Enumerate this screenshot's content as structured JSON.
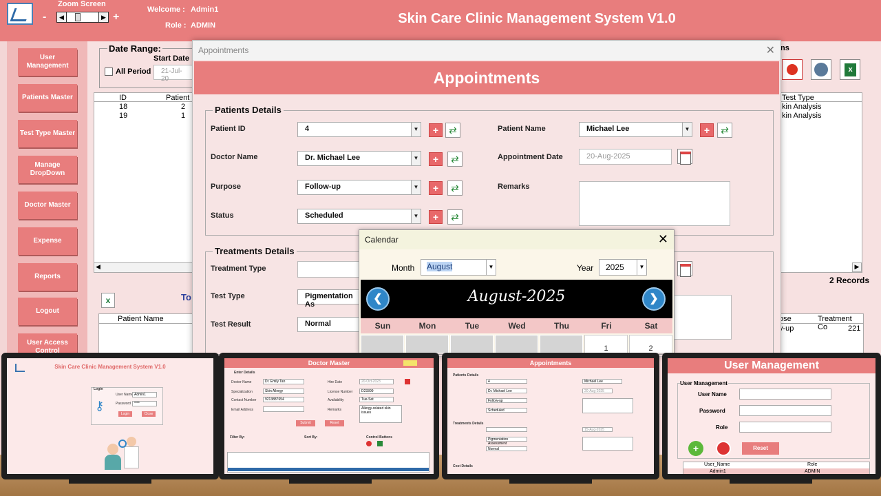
{
  "app": {
    "title": "Skin Care Clinic Management System V1.0",
    "zoom_label": "Zoom Screen",
    "zoom_minus": "-",
    "zoom_plus": "+",
    "welcome_label": "Welcome :",
    "welcome_value": "Admin1",
    "role_label": "Role :",
    "role_value": "ADMIN"
  },
  "sidebar": {
    "items": [
      {
        "label": "User Management"
      },
      {
        "label": "Patients Master"
      },
      {
        "label": "Test Type Master"
      },
      {
        "label": "Manage DropDown"
      },
      {
        "label": "Doctor Master"
      },
      {
        "label": "Expense"
      },
      {
        "label": "Reports"
      },
      {
        "label": "Logout"
      },
      {
        "label": "User Access Control"
      }
    ]
  },
  "background": {
    "date_range_label": "Date Range:",
    "start_date_label": "Start Date",
    "all_period_label": "All Period",
    "start_date_value": "21-Jul-20",
    "table_col_id": "ID",
    "table_col_patient": "Patient",
    "rows": [
      {
        "id": "18",
        "patient": "2"
      },
      {
        "id": "19",
        "patient": "1"
      }
    ],
    "right_col_test_type": "Test Type",
    "right_rows": [
      "kin Analysis",
      "kin Analysis"
    ],
    "ns_text": "ns",
    "records_text": "2 Records",
    "to_text": "To",
    "bottom_col_patient_name": "Patient Name",
    "bottom_col_pose": "ose",
    "bottom_col_treatment_cost": "Treatment Co",
    "bottom_row_up": "v-up",
    "bottom_row_cost": "221"
  },
  "appointments": {
    "window_title": "Appointments",
    "header": "Appointments",
    "patients_frame": "Patients Details",
    "patient_id_label": "Patient ID",
    "patient_id_value": "4",
    "patient_name_label": "Patient Name",
    "patient_name_value": "Michael Lee",
    "doctor_name_label": "Doctor Name",
    "doctor_name_value": "Dr. Michael Lee",
    "appointment_date_label": "Appointment Date",
    "appointment_date_value": "20-Aug-2025",
    "purpose_label": "Purpose",
    "purpose_value": "Follow-up",
    "remarks_label": "Remarks",
    "status_label": "Status",
    "status_value": "Scheduled",
    "treatments_frame": "Treatments Details",
    "treatment_type_label": "Treatment Type",
    "test_type_label": "Test Type",
    "test_type_value": "Pigmentation As",
    "test_result_label": "Test Result",
    "test_result_value": "Normal"
  },
  "calendar": {
    "title": "Calendar",
    "month_label": "Month",
    "month_value": "August",
    "year_label": "Year",
    "year_value": "2025",
    "banner": "August-2025",
    "days": [
      "Sun",
      "Mon",
      "Tue",
      "Wed",
      "Thu",
      "Fri",
      "Sat"
    ],
    "first_row": [
      "",
      "",
      "",
      "",
      "",
      "1",
      "2"
    ]
  },
  "monitors": {
    "m1_title": "Skin Care Clinic Management System V1.0",
    "m1_login": "Login",
    "m1_user_name": "User Name",
    "m1_user_value": "Admin1",
    "m1_password": "Password",
    "m1_password_value": "****",
    "m1_login_btn": "Login",
    "m1_close_btn": "Close",
    "m2_title": "Doctor Master",
    "m2_section": "Enter Details",
    "m2_doctor_name_label": "Doctor Name",
    "m2_doctor_name": "Dr. Emily Tan",
    "m2_hire_date_label": "Hire Date",
    "m2_hire_date": "20-Oct-2023",
    "m2_specialization_label": "Specialization",
    "m2_specialization": "Skin Allergy",
    "m2_license_label": "License Number",
    "m2_license": "D23399",
    "m2_contact_label": "Contact Number",
    "m2_contact": "9213887654",
    "m2_availability_label": "Availability",
    "m2_availability": "Tue-Sat",
    "m2_email_label": "Email Address",
    "m2_remarks_label": "Remarks",
    "m2_remarks": "Allergy-related skin issues",
    "m2_submit": "Submit",
    "m2_reset": "Reset",
    "m2_filter_by": "Filter By:",
    "m2_sort_by": "Sort By:",
    "m2_control_buttons": "Control Buttons",
    "m3_title": "Appointments",
    "m3_patients_details": "Patients Details",
    "m3_patient_id": "4",
    "m3_patient_name": "Michael Lee",
    "m3_doctor": "Dr. Michael Lee",
    "m3_appt_date": "20-Aug-2025",
    "m3_purpose": "Follow-up",
    "m3_status": "Scheduled",
    "m3_treatments": "Treatments Details",
    "m3_test_type": "Pigmentation Assessment",
    "m3_result": "Normal",
    "m3_test_date": "15-Aug-2025",
    "m3_cost_details": "Cost Details",
    "m4_title": "User Management",
    "m4_section": "User Management",
    "m4_user_name": "User Name",
    "m4_password": "Password",
    "m4_role": "Role",
    "m4_reset": "Reset",
    "m4_col_user": "User_Name",
    "m4_col_role": "Role",
    "m4_row_user": "Admin1",
    "m4_row_role": "ADMIN"
  },
  "colors": {
    "accent": "#e87d7d",
    "panel": "#f7e4e4",
    "calendar_banner": "#000000"
  }
}
